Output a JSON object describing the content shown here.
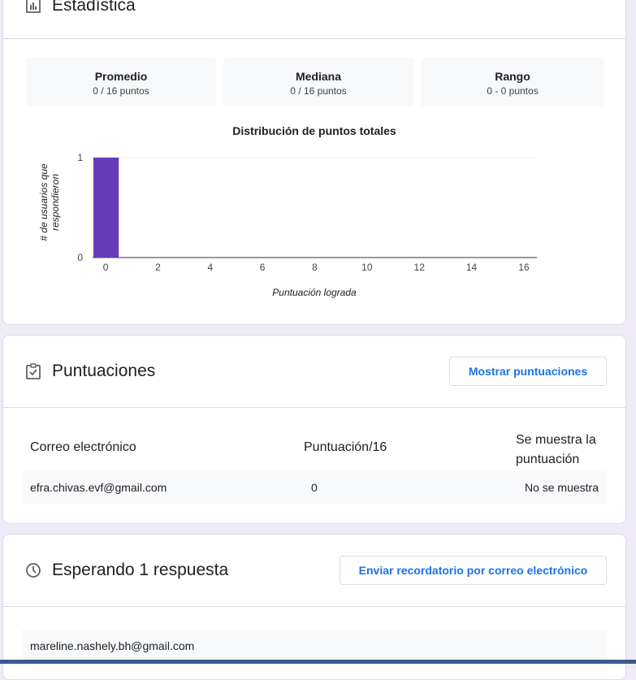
{
  "stats": {
    "title": "Estadística",
    "boxes": [
      {
        "label": "Promedio",
        "value": "0 / 16 puntos"
      },
      {
        "label": "Mediana",
        "value": "0 / 16 puntos"
      },
      {
        "label": "Rango",
        "value": "0 - 0 puntos"
      }
    ]
  },
  "chart_data": {
    "type": "bar",
    "title": "Distribución de puntos totales",
    "xlabel": "Puntuación lograda",
    "ylabel": "# de usuarios que respondieron",
    "x_ticks": [
      "0",
      "2",
      "4",
      "6",
      "8",
      "10",
      "12",
      "14",
      "16"
    ],
    "y_ticks": [
      "0",
      "1"
    ],
    "categories": [
      "0",
      "1",
      "2",
      "3",
      "4",
      "5",
      "6",
      "7",
      "8",
      "9",
      "10",
      "11",
      "12",
      "13",
      "14",
      "15",
      "16"
    ],
    "values": [
      1,
      0,
      0,
      0,
      0,
      0,
      0,
      0,
      0,
      0,
      0,
      0,
      0,
      0,
      0,
      0,
      0
    ],
    "xlim": [
      0,
      16
    ],
    "ylim": [
      0,
      1
    ],
    "bar_color": "#673ab7",
    "grid": true
  },
  "scores": {
    "title": "Puntuaciones",
    "show_button": "Mostrar puntuaciones",
    "columns": {
      "email": "Correo electrónico",
      "score": "Puntuación/16",
      "shown_line1": "Se muestra la",
      "shown_line2": "puntuación"
    },
    "rows": [
      {
        "email": "efra.chivas.evf@gmail.com",
        "score": "0",
        "shown": "No se muestra"
      }
    ]
  },
  "pending": {
    "title": "Esperando 1 respuesta",
    "remind_button": "Enviar recordatorio por correo electrónico",
    "emails": [
      "mareline.nashely.bh@gmail.com"
    ]
  },
  "colors": {
    "accent": "#673ab7",
    "link": "#1a73e8",
    "background": "#f0ebf8"
  }
}
